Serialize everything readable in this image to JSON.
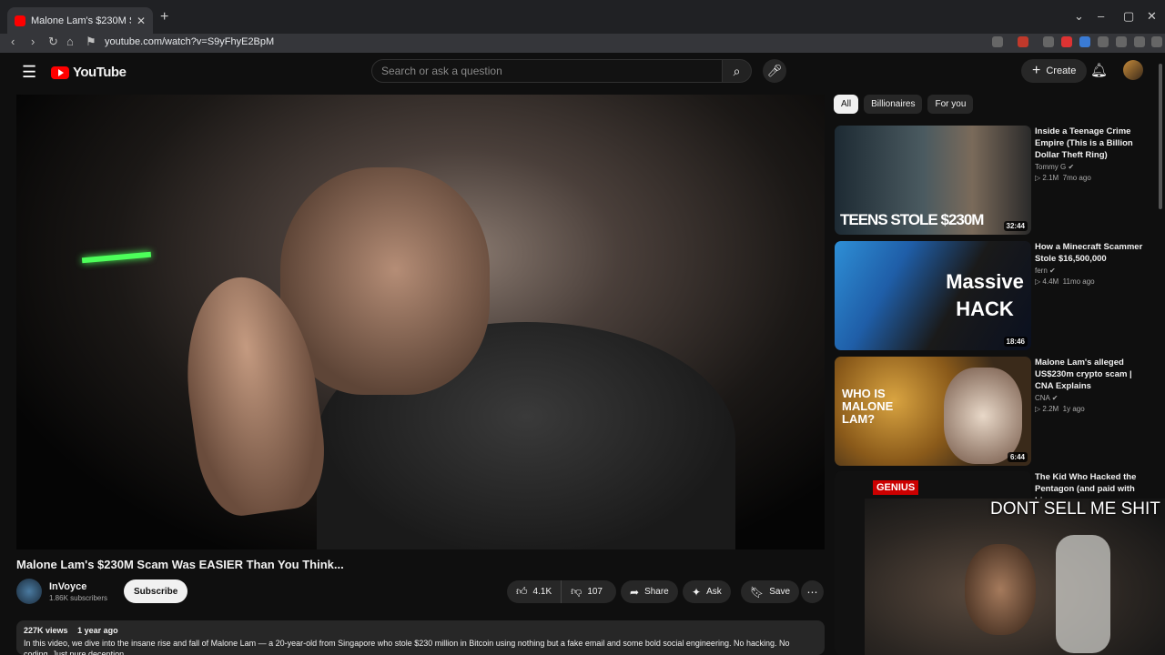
{
  "browser": {
    "tab_title": "Malone Lam's $230M Scam W",
    "url": "youtube.com/watch?v=S9yFhyE2BpM",
    "close": "✕",
    "new_tab": "+"
  },
  "header": {
    "logo_text": "YouTube",
    "search_placeholder": "Search or ask a question",
    "create_label": "Create"
  },
  "video": {
    "title": "Malone Lam's $230M Scam Was EASIER Than You Think...",
    "channel_name": "InVoyce",
    "subscribers": "1.86K subscribers",
    "subscribe_label": "Subscribe",
    "likes": "4.1K",
    "dislikes": "107",
    "share_label": "Share",
    "ask_label": "Ask",
    "save_label": "Save",
    "views": "227K views",
    "age": "1 year ago",
    "description": "In this video, we dive into the insane rise and fall of Malone Lam — a 20-year-old from Singapore who stole $230 million in Bitcoin using nothing but a fake email and some bold social engineering. No hacking. No coding. Just pure deception."
  },
  "chips": [
    "All",
    "Billionaires",
    "For you"
  ],
  "recommendations": [
    {
      "title": "Inside a Teenage Crime Empire (This is a Billion Dollar Theft Ring)",
      "channel": "Tommy G",
      "views": "2.1M",
      "age": "7mo ago",
      "duration": "32:44",
      "thumb_text": "TEENS STOLE $230M"
    },
    {
      "title": "How a Minecraft Scammer Stole $16,500,000",
      "channel": "fern",
      "views": "4.4M",
      "age": "11mo ago",
      "duration": "18:46",
      "thumb_text": "Massive HACK"
    },
    {
      "title": "Malone Lam's alleged US$230m crypto scam | CNA Explains",
      "channel": "CNA",
      "views": "2.2M",
      "age": "1y ago",
      "duration": "6:44",
      "thumb_text": "WHO IS MALONE LAM?"
    },
    {
      "title": "The Kid Who Hacked the Pentagon (and paid with his",
      "channel": "",
      "views": "",
      "age": "",
      "duration": "",
      "thumb_text": "GENIUS"
    }
  ],
  "overlay": {
    "caption": "DONT SELL ME SHIT"
  },
  "colors": {
    "brand_red": "#ff0000",
    "background": "#0f0f0f",
    "pill": "#272727"
  }
}
